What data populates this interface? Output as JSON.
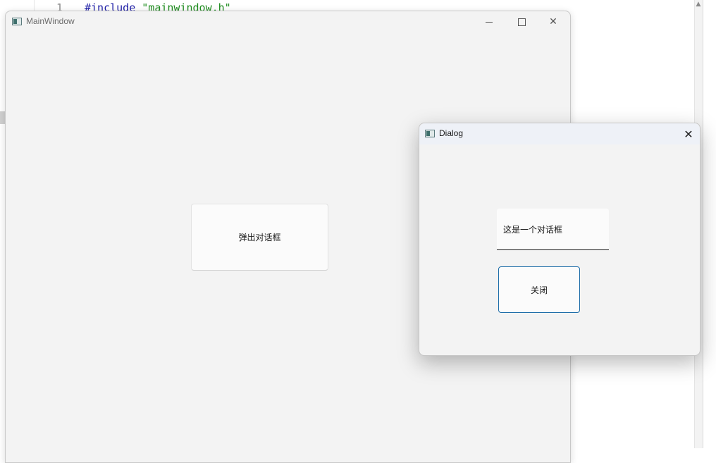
{
  "editor": {
    "line_number": "1",
    "code_keyword": "#include",
    "code_string": "\"mainwindow.h\""
  },
  "main_window": {
    "title": "MainWindow",
    "popup_button_label": "弹出对话框"
  },
  "dialog": {
    "title": "Dialog",
    "label_text": "这是一个对话框",
    "close_button_label": "关闭"
  },
  "icons": {
    "minimize": "minimize-icon",
    "maximize": "maximize-icon",
    "close": "close-icon",
    "app": "app-icon"
  },
  "colors": {
    "window_bg": "#f3f3f3",
    "dialog_titlebar": "#eef1f7",
    "focus_border": "#1d6da8",
    "code_keyword": "#1a1aa6",
    "code_string": "#1d8c1d"
  }
}
